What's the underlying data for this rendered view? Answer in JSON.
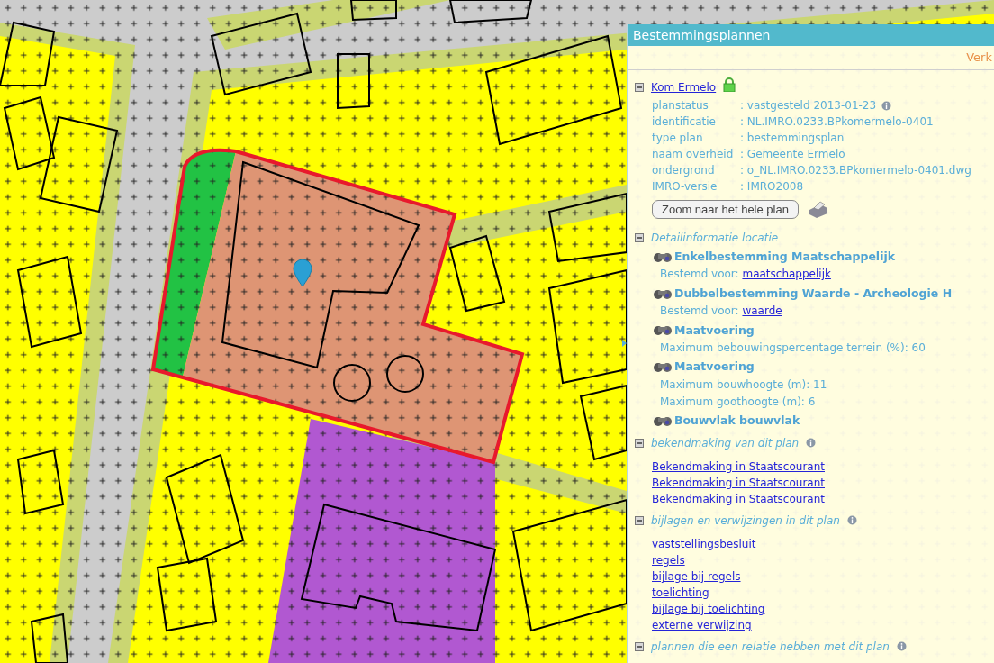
{
  "panel": {
    "title": "Bestemmingsplannen",
    "tab_label": "Verk"
  },
  "plan": {
    "name": "Kom Ermelo",
    "expanded": true,
    "properties": [
      {
        "label": "planstatus",
        "value": ": vastgesteld 2013-01-23",
        "info": true
      },
      {
        "label": "identificatie",
        "value": ": NL.IMRO.0233.BPkomermelo-0401",
        "info": false
      },
      {
        "label": "type plan",
        "value": ": bestemmingsplan",
        "info": false
      },
      {
        "label": "naam overheid",
        "value": ": Gemeente Ermelo",
        "info": false
      },
      {
        "label": "ondergrond",
        "value": ": o_NL.IMRO.0233.BPkomermelo-0401.dwg",
        "info": false
      },
      {
        "label": "IMRO-versie",
        "value": ": IMRO2008",
        "info": false
      }
    ],
    "zoom_button": "Zoom naar het hele plan"
  },
  "detail": {
    "heading": "Detailinformatie locatie",
    "expanded": true,
    "items": [
      {
        "title": "Enkelbestemming Maatschappelijk",
        "lines": [
          {
            "kind": "link",
            "text": "Bestemd voor: ",
            "link": "maatschappelijk"
          }
        ]
      },
      {
        "title": "Dubbelbestemming Waarde - Archeologie H",
        "lines": [
          {
            "kind": "link",
            "text": "Bestemd voor: ",
            "link": "waarde"
          }
        ]
      },
      {
        "title": "Maatvoering",
        "lines": [
          {
            "kind": "text",
            "text": "Maximum bebouwingspercentage terrein (%): 60"
          }
        ]
      },
      {
        "title": "Maatvoering",
        "lines": [
          {
            "kind": "text",
            "text": "Maximum bouwhoogte (m): 11"
          },
          {
            "kind": "text",
            "text": "Maximum goothoogte (m): 6"
          }
        ]
      },
      {
        "title": "Bouwvlak bouwvlak"
      }
    ]
  },
  "sections": [
    {
      "heading": "bekendmaking van dit plan",
      "expanded": true,
      "links": [
        "Bekendmaking in Staatscourant",
        "Bekendmaking in Staatscourant",
        "Bekendmaking in Staatscourant"
      ]
    },
    {
      "heading": "bijlagen en verwijzingen in dit plan",
      "expanded": true,
      "links": [
        "vaststellingsbesluit",
        "regels",
        "bijlage bij regels",
        "toelichting",
        "bijlage bij toelichting",
        "externe verwijzing"
      ]
    },
    {
      "heading": "plannen die een relatie hebben met dit plan",
      "expanded": true
    }
  ]
}
